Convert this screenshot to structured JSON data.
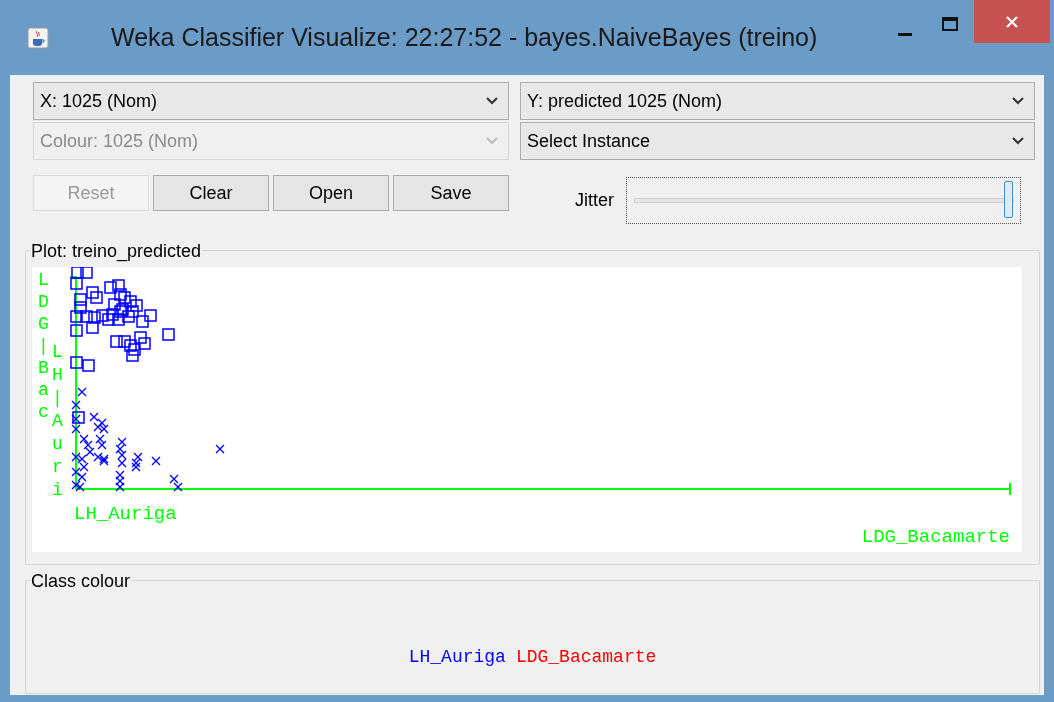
{
  "window": {
    "title": "Weka Classifier Visualize: 22:27:52 - bayes.NaiveBayes (treino)"
  },
  "selectors": [
    {
      "value": "X: 1025 (Nom)",
      "disabled": false
    },
    {
      "value": "Y: predicted 1025 (Nom)",
      "disabled": false
    },
    {
      "value": "Colour: 1025 (Nom)",
      "disabled": true
    },
    {
      "value": "Select Instance",
      "disabled": false
    }
  ],
  "buttons": [
    {
      "label": "Reset",
      "disabled": true
    },
    {
      "label": "Clear",
      "disabled": false
    },
    {
      "label": "Open",
      "disabled": false
    },
    {
      "label": "Save",
      "disabled": false
    }
  ],
  "jitter": {
    "label": "Jitter",
    "level": 1.0
  },
  "plot": {
    "title": "Plot: treino_predicted",
    "y_labels": [
      "LDG|Bac",
      "LH|Auri"
    ],
    "x_labels": [
      "LH_Auriga",
      "LDG_Bacamarte"
    ]
  },
  "class_colour": {
    "title": "Class colour",
    "classes": [
      {
        "name": "LH_Auriga",
        "color": "#0000ff"
      },
      {
        "name": "LDG_Bacamarte",
        "color": "#ff0000"
      }
    ]
  }
}
